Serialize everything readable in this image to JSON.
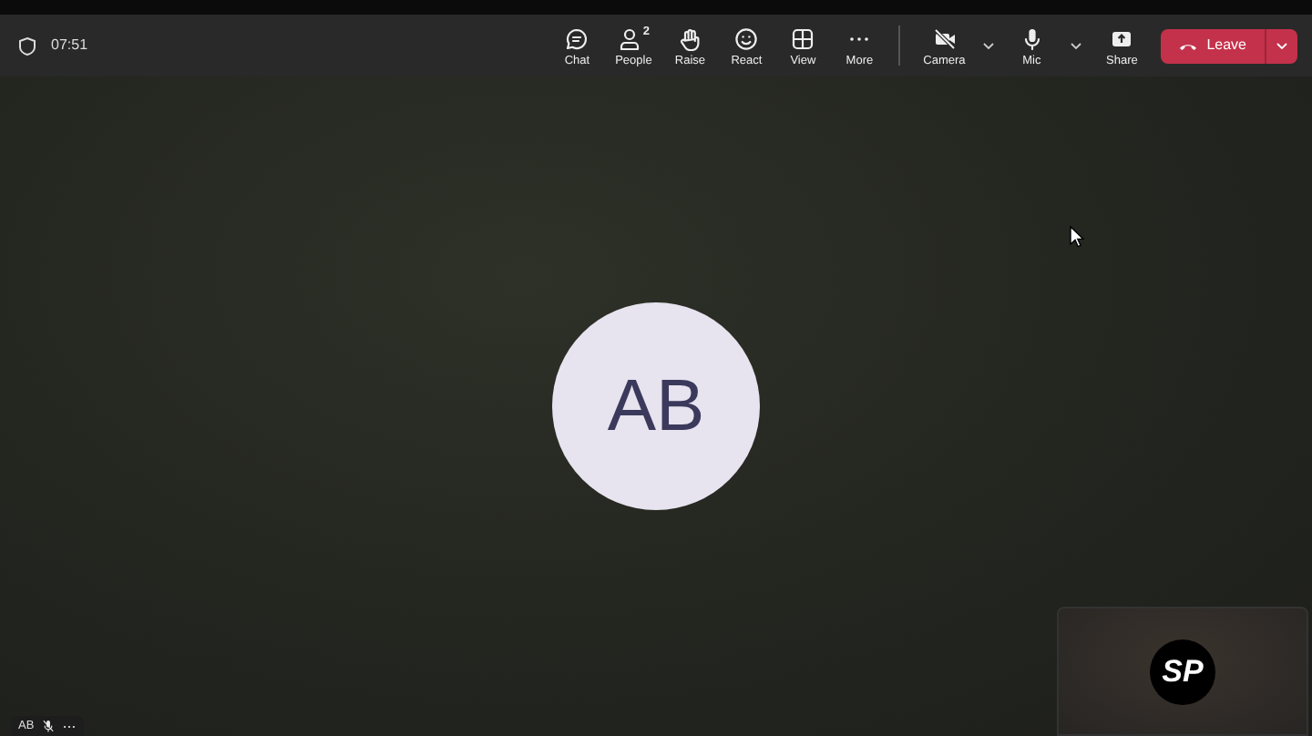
{
  "meeting": {
    "timer": "07:51"
  },
  "toolbar": {
    "buttons": [
      {
        "kind": "chat",
        "label": "Chat"
      },
      {
        "kind": "people",
        "label": "People",
        "count": "2"
      },
      {
        "kind": "raise",
        "label": "Raise"
      },
      {
        "kind": "react",
        "label": "React"
      },
      {
        "kind": "view",
        "label": "View"
      },
      {
        "kind": "more",
        "label": "More"
      }
    ],
    "devices": [
      {
        "kind": "camera",
        "label": "Camera",
        "on": false
      },
      {
        "kind": "mic",
        "label": "Mic",
        "on": true
      }
    ],
    "share": {
      "label": "Share"
    },
    "leave": {
      "label": "Leave"
    }
  },
  "participant": {
    "initials": "AB"
  },
  "name_tag": {
    "initials": "AB",
    "muted": true
  },
  "self_view": {
    "initials": "SP"
  }
}
